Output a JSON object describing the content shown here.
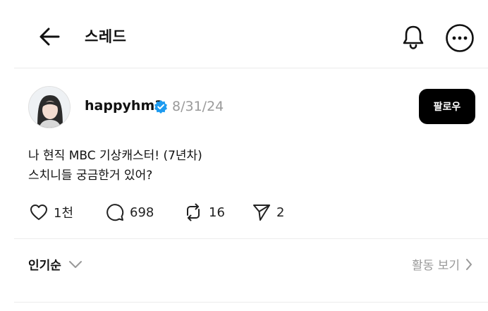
{
  "header": {
    "title": "스레드",
    "back_icon": "arrow-left-icon",
    "notification_icon": "bell-icon",
    "more_icon": "more-horizontal-icon"
  },
  "post": {
    "username": "happyhm3",
    "verified": true,
    "date": "8/31/24",
    "follow_label": "팔로우",
    "text_lines": [
      "나 현직 MBC 기상캐스터! (7년차)",
      "스치니들 궁금한거 있어?"
    ],
    "actions": {
      "likes": "1천",
      "comments": "698",
      "reposts": "16",
      "shares": "2"
    }
  },
  "footer": {
    "sort_label": "인기순",
    "activity_label": "활동 보기"
  },
  "colors": {
    "verified_badge": "#1d9bf0",
    "follow_bg": "#000000",
    "muted_text": "#999999"
  }
}
